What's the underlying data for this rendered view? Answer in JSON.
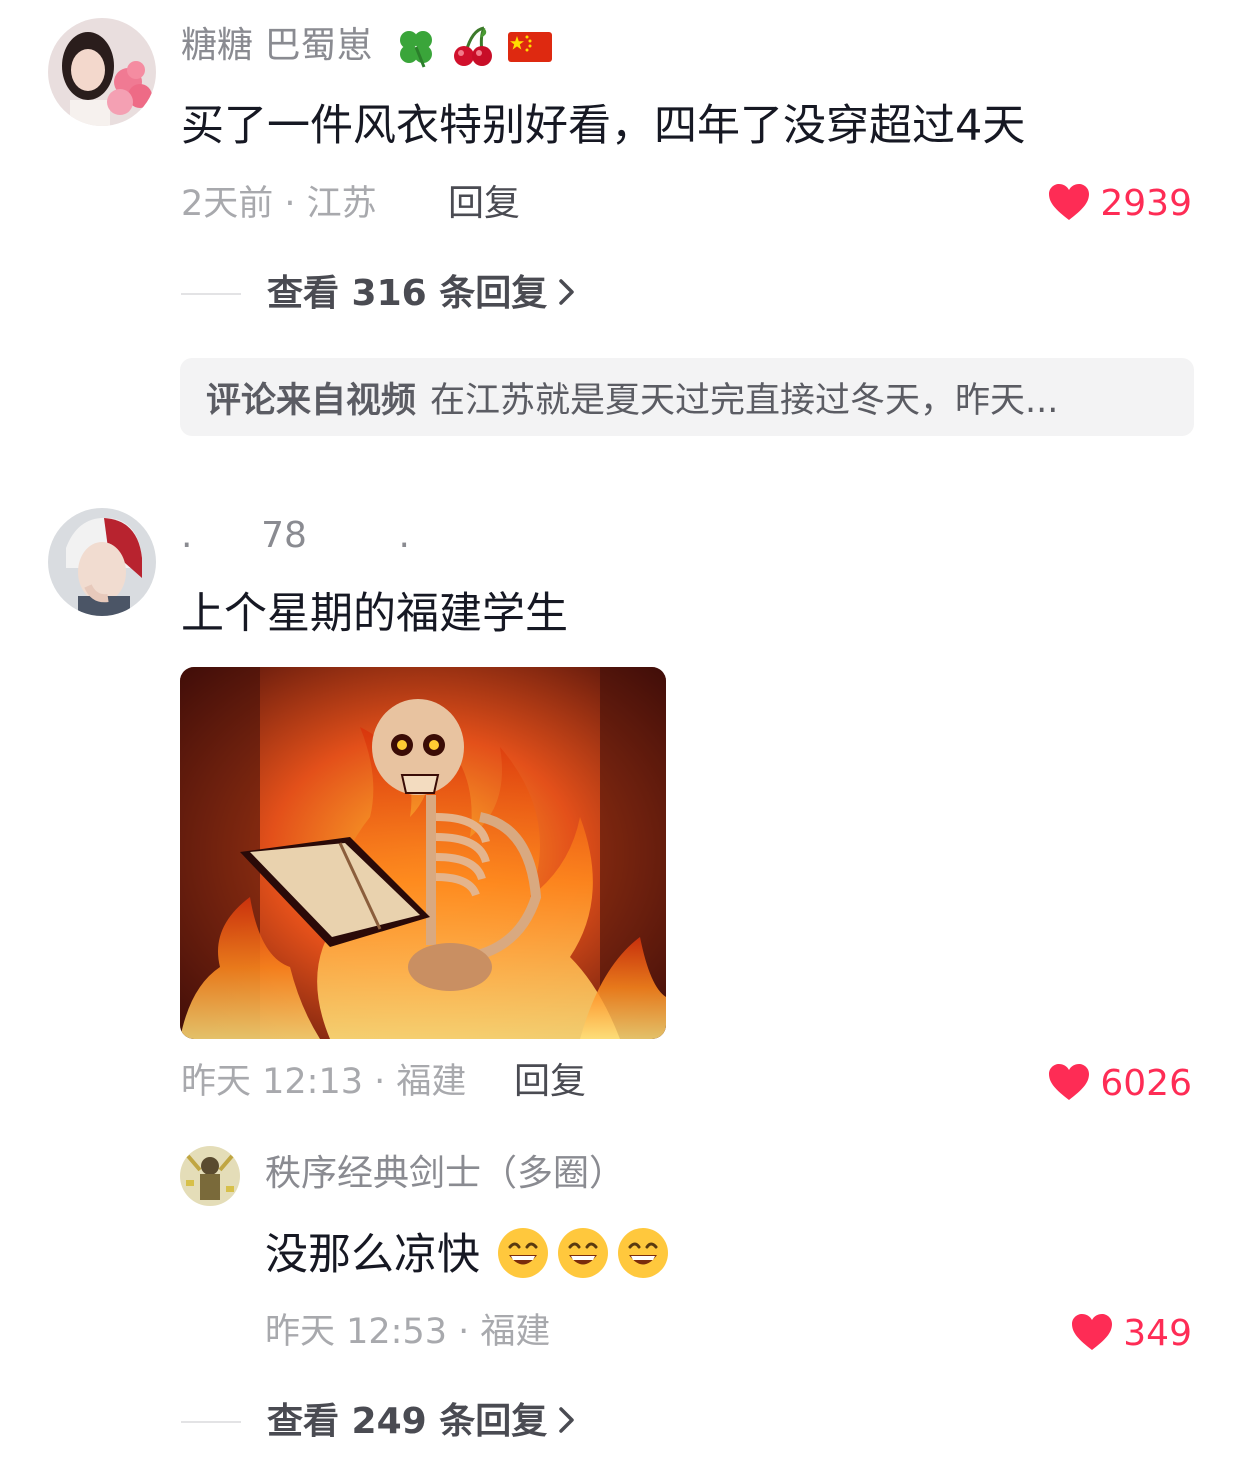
{
  "comments": [
    {
      "username": "糖糖 巴蜀崽",
      "badges": [
        "clover-icon",
        "cherry-icon",
        "china-flag-icon"
      ],
      "text": "买了一件风衣特别好看，四年了没穿超过4天",
      "time_location": "2天前 · 江苏",
      "reply_label": "回复",
      "likes": "2939",
      "view_replies": "查看 316 条回复",
      "source_label": "评论来自视频",
      "source_text": "在江苏就是夏天过完直接过冬天，昨天..."
    },
    {
      "username": ".      78        .",
      "text": "上个星期的福建学生",
      "image": "burning-skeleton-reading-book",
      "time_location": "昨天 12:13 · 福建",
      "reply_label": "回复",
      "likes": "6026",
      "reply": {
        "username": "秩序经典剑士（多圈）",
        "text": "没那么凉快",
        "emojis": [
          "grin-emoji",
          "grin-emoji",
          "grin-emoji"
        ],
        "time_location": "昨天 12:53 · 福建",
        "likes": "349"
      },
      "view_replies": "查看 249 条回复"
    }
  ],
  "colors": {
    "like": "#fe2c55",
    "meta": "#a8a9ad",
    "username": "#8a8b91",
    "text": "#161823"
  }
}
